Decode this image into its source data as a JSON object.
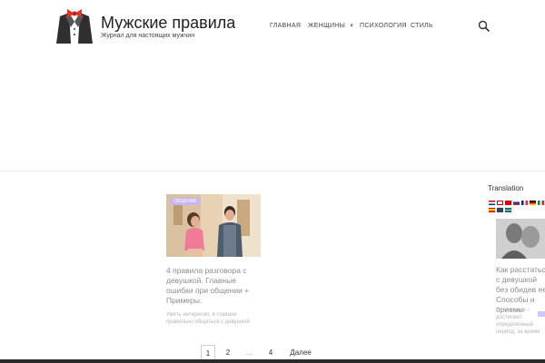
{
  "header": {
    "title": "Мужские правила",
    "tagline": "Журнал для настоящих мужчин"
  },
  "nav": [
    {
      "label": "ГЛАВНАЯ"
    },
    {
      "label": "ЖЕНЩИНЫ"
    },
    {
      "label": "ПСИХОЛОГИЯ"
    },
    {
      "label": "СТИЛЬ"
    }
  ],
  "post": {
    "badge": "ОБЩЕНИЕ",
    "title": "4 правила разговора с девушкой. Главные ошибки при общении + Примеры.",
    "excerpt": "Уметь интересно, в главное правильно общаться с девушкой"
  },
  "sidebar": {
    "title": "Translation",
    "post_title": "Как расстаться с девушкой без обидев ее. Способы и приемы",
    "post_excerpt": "Отношения – достигают определенный период, за время"
  },
  "pagination": {
    "pages": [
      "1",
      "2",
      "...",
      "4"
    ],
    "next": "Далее"
  },
  "colors": {
    "badge": "#c9b4f4",
    "bottom_bar": "#2a2a2a",
    "muted_text": "#8c8c8c"
  }
}
